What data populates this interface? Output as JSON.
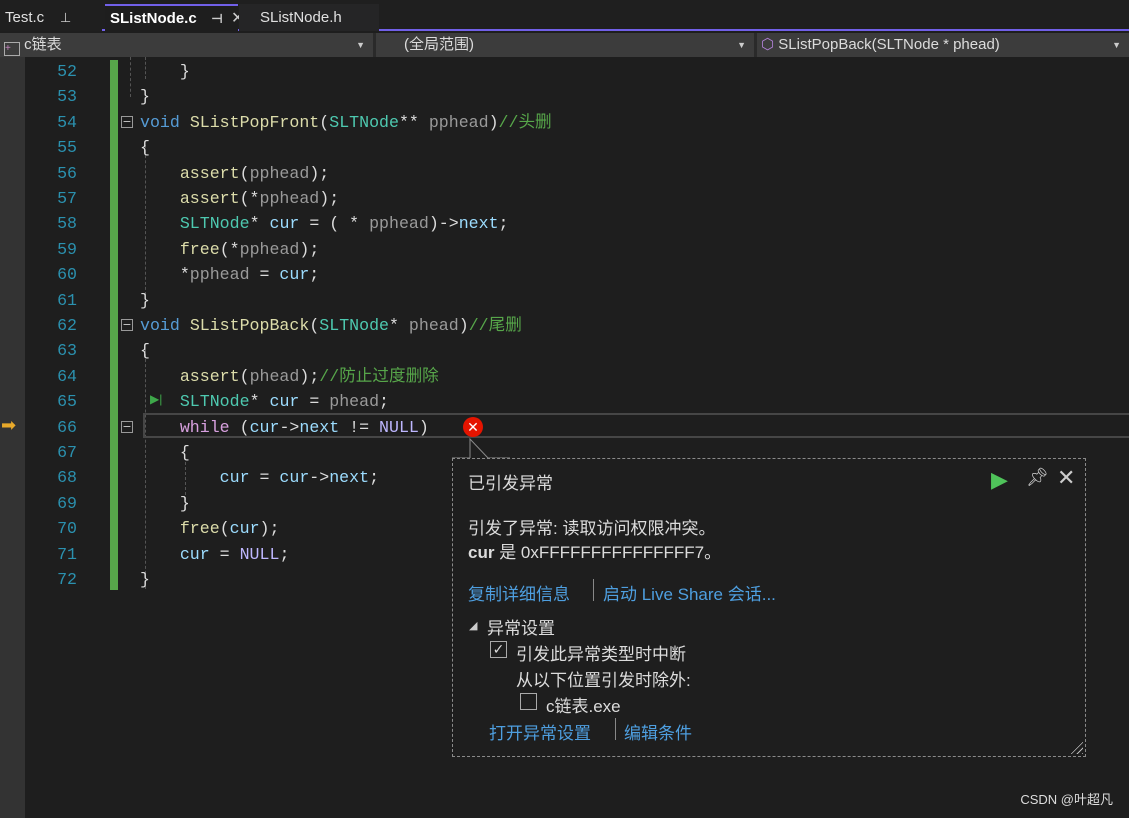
{
  "tabs": [
    {
      "label": "Test.c",
      "pin": "pin-icon"
    },
    {
      "label": "SListNode.c",
      "pin": "pin-icon",
      "close": "close-icon",
      "active": true
    },
    {
      "label": "SListNode.h"
    }
  ],
  "nav": {
    "project": "c链表",
    "scope": "(全局范围)",
    "member": "SListPopBack(SLTNode * phead)"
  },
  "code": [
    {
      "n": 52,
      "t": [
        [
          "    }",
          "pl"
        ]
      ]
    },
    {
      "n": 53,
      "t": [
        [
          "}",
          "pl"
        ]
      ]
    },
    {
      "n": 54,
      "t": [
        [
          "void",
          "kw"
        ],
        [
          " ",
          "pl"
        ],
        [
          "SListPopFront",
          "fn"
        ],
        [
          "(",
          "pl"
        ],
        [
          "SLTNode",
          "ty"
        ],
        [
          "** ",
          "pl"
        ],
        [
          "pphead",
          "par"
        ],
        [
          ")",
          "pl"
        ],
        [
          "//头删",
          "cm"
        ]
      ]
    },
    {
      "n": 55,
      "t": [
        [
          "{",
          "pl"
        ]
      ]
    },
    {
      "n": 56,
      "t": [
        [
          "    ",
          "pl"
        ],
        [
          "assert",
          "fn"
        ],
        [
          "(",
          "pl"
        ],
        [
          "pphead",
          "par"
        ],
        [
          ");",
          "pl"
        ]
      ]
    },
    {
      "n": 57,
      "t": [
        [
          "    ",
          "pl"
        ],
        [
          "assert",
          "fn"
        ],
        [
          "(*",
          "pl"
        ],
        [
          "pphead",
          "par"
        ],
        [
          ");",
          "pl"
        ]
      ]
    },
    {
      "n": 58,
      "t": [
        [
          "    ",
          "pl"
        ],
        [
          "SLTNode",
          "ty"
        ],
        [
          "* ",
          "pl"
        ],
        [
          "cur",
          "var"
        ],
        [
          " = ( * ",
          "pl"
        ],
        [
          "pphead",
          "par"
        ],
        [
          ")->",
          "pl"
        ],
        [
          "next",
          "var"
        ],
        [
          ";",
          "pl"
        ]
      ]
    },
    {
      "n": 59,
      "t": [
        [
          "    ",
          "pl"
        ],
        [
          "free",
          "fn"
        ],
        [
          "(*",
          "pl"
        ],
        [
          "pphead",
          "par"
        ],
        [
          ");",
          "pl"
        ]
      ]
    },
    {
      "n": 60,
      "t": [
        [
          "    *",
          "pl"
        ],
        [
          "pphead",
          "par"
        ],
        [
          " = ",
          "pl"
        ],
        [
          "cur",
          "var"
        ],
        [
          ";",
          "pl"
        ]
      ]
    },
    {
      "n": 61,
      "t": [
        [
          "}",
          "pl"
        ]
      ]
    },
    {
      "n": 62,
      "t": [
        [
          "void",
          "kw"
        ],
        [
          " ",
          "pl"
        ],
        [
          "SListPopBack",
          "fn"
        ],
        [
          "(",
          "pl"
        ],
        [
          "SLTNode",
          "ty"
        ],
        [
          "* ",
          "pl"
        ],
        [
          "phead",
          "par"
        ],
        [
          ")",
          "pl"
        ],
        [
          "//尾删",
          "cm"
        ]
      ]
    },
    {
      "n": 63,
      "t": [
        [
          "{",
          "pl"
        ]
      ]
    },
    {
      "n": 64,
      "t": [
        [
          "    ",
          "pl"
        ],
        [
          "assert",
          "fn"
        ],
        [
          "(",
          "pl"
        ],
        [
          "phead",
          "par"
        ],
        [
          ");",
          "pl"
        ],
        [
          "//防止过度删除",
          "cm"
        ]
      ]
    },
    {
      "n": 65,
      "t": [
        [
          "    ",
          "pl"
        ],
        [
          "SLTNode",
          "ty"
        ],
        [
          "* ",
          "pl"
        ],
        [
          "cur",
          "var"
        ],
        [
          " = ",
          "pl"
        ],
        [
          "phead",
          "par"
        ],
        [
          ";",
          "pl"
        ]
      ]
    },
    {
      "n": 66,
      "t": [
        [
          "    ",
          "pl"
        ],
        [
          "while",
          "ctl"
        ],
        [
          " (",
          "pl"
        ],
        [
          "cur",
          "var"
        ],
        [
          "->",
          "pl"
        ],
        [
          "next",
          "var"
        ],
        [
          " != ",
          "pl"
        ],
        [
          "NULL",
          "mac"
        ],
        [
          ")",
          "pl"
        ]
      ]
    },
    {
      "n": 67,
      "t": [
        [
          "    {",
          "pl"
        ]
      ]
    },
    {
      "n": 68,
      "t": [
        [
          "        ",
          "pl"
        ],
        [
          "cur",
          "var"
        ],
        [
          " = ",
          "pl"
        ],
        [
          "cur",
          "var"
        ],
        [
          "->",
          "pl"
        ],
        [
          "next",
          "var"
        ],
        [
          ";",
          "pl"
        ]
      ]
    },
    {
      "n": 69,
      "t": [
        [
          "    }",
          "pl"
        ]
      ]
    },
    {
      "n": 70,
      "t": [
        [
          "    ",
          "pl"
        ],
        [
          "free",
          "fn"
        ],
        [
          "(",
          "pl"
        ],
        [
          "cur",
          "var"
        ],
        [
          ");",
          "pl"
        ]
      ]
    },
    {
      "n": 71,
      "t": [
        [
          "    ",
          "pl"
        ],
        [
          "cur",
          "var"
        ],
        [
          " = ",
          "pl"
        ],
        [
          "NULL",
          "mac"
        ],
        [
          ";",
          "pl"
        ]
      ]
    },
    {
      "n": 72,
      "t": [
        [
          "}",
          "pl"
        ]
      ]
    }
  ],
  "popup": {
    "title": "已引发异常",
    "message": "引发了异常: 读取访问权限冲突。",
    "detail_var": "cur",
    "detail_rest": " 是 0xFFFFFFFFFFFFFFF7。",
    "copy_link": "复制详细信息",
    "liveshare_link": "启动 Live Share 会话...",
    "settings_header": "异常设置",
    "break_label": "引发此异常类型时中断",
    "break_checked": true,
    "except_label": "从以下位置引发时除外:",
    "exe_label": "c链表.exe",
    "exe_checked": false,
    "open_settings_link": "打开异常设置",
    "edit_conditions_link": "编辑条件"
  },
  "watermark": "CSDN @叶超凡",
  "colors": {
    "accent": "#7160e8",
    "line_number": "#2b91af",
    "change_bar": "#57a64a",
    "link": "#4e9fe0",
    "error": "#e51400"
  }
}
